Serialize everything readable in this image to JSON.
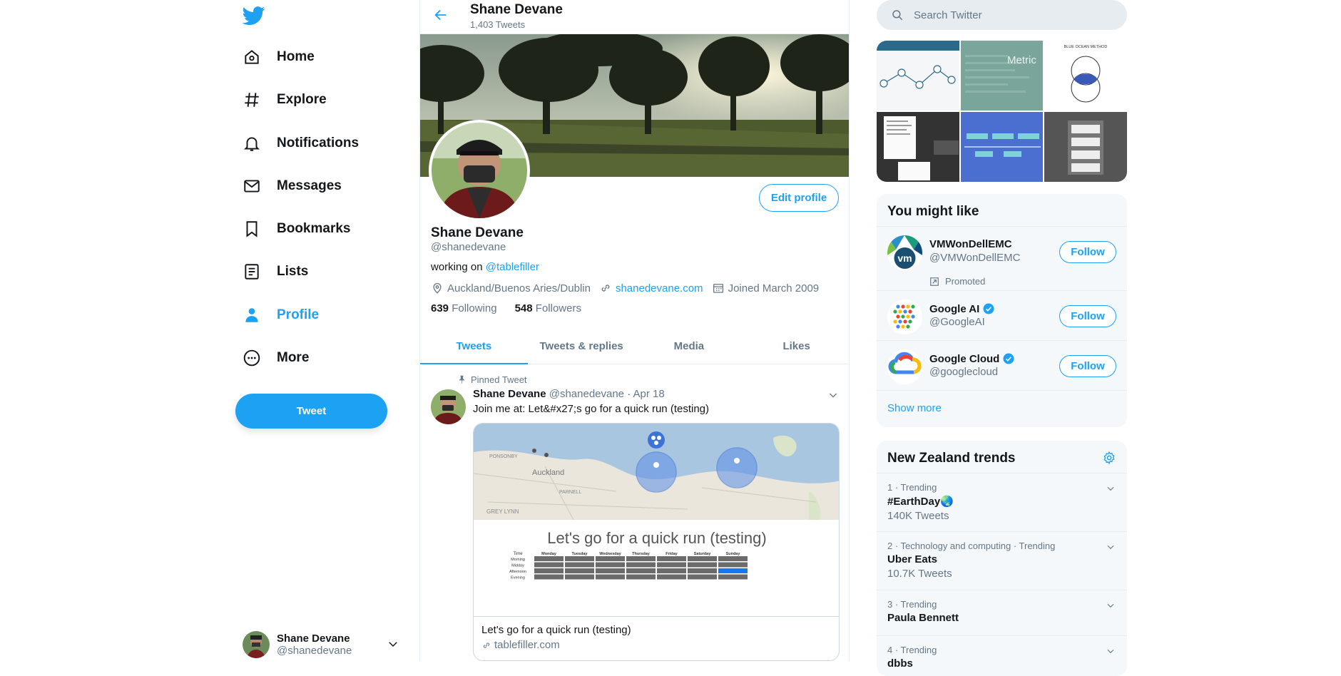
{
  "nav": {
    "items": [
      {
        "label": "Home",
        "icon": "home-icon"
      },
      {
        "label": "Explore",
        "icon": "hashtag-icon"
      },
      {
        "label": "Notifications",
        "icon": "bell-icon"
      },
      {
        "label": "Messages",
        "icon": "mail-icon"
      },
      {
        "label": "Bookmarks",
        "icon": "bookmark-icon"
      },
      {
        "label": "Lists",
        "icon": "list-icon"
      },
      {
        "label": "Profile",
        "icon": "person-icon",
        "active": true
      },
      {
        "label": "More",
        "icon": "more-circle-icon"
      }
    ],
    "tweet_button": "Tweet",
    "account": {
      "name": "Shane Devane",
      "handle": "@shanedevane"
    }
  },
  "header": {
    "title": "Shane Devane",
    "subtitle": "1,403 Tweets"
  },
  "profile": {
    "edit_button": "Edit profile",
    "name": "Shane Devane",
    "handle": "@shanedevane",
    "bio_prefix": "working on ",
    "bio_link": "@tablefiller",
    "location": "Auckland/Buenos Aries/Dublin",
    "website": "shanedevane.com",
    "joined": "Joined March 2009",
    "following_count": "639",
    "following_label": "Following",
    "followers_count": "548",
    "followers_label": "Followers"
  },
  "tabs": [
    "Tweets",
    "Tweets & replies",
    "Media",
    "Likes"
  ],
  "pinned_tweet": {
    "pinned_label": "Pinned Tweet",
    "author": "Shane Devane",
    "handle": "@shanedevane",
    "date": "· Apr 18",
    "text": "Join me at: Let&#x27;s go for a quick run (testing)",
    "card": {
      "image_title": "Let's go for a quick run (testing)",
      "table_days": [
        "Monday",
        "Tuesday",
        "Wednesday",
        "Thursday",
        "Friday",
        "Saturday",
        "Sunday"
      ],
      "table_times": [
        "Morning",
        "Midday",
        "Afternoon",
        "Evening"
      ],
      "table_header_time": "Time",
      "map_labels": [
        "Auckland",
        "PONSONBY",
        "PARNELL",
        "GREY LYNN"
      ],
      "title": "Let's go for a quick run (testing)",
      "url": "tablefiller.com"
    }
  },
  "search": {
    "placeholder": "Search Twitter"
  },
  "media_thumbs": [
    {
      "accent": "#2d6a8a"
    },
    {
      "accent": "#7aa59a",
      "text": "Metric"
    },
    {
      "accent": "#ffffff",
      "text": "BLUE OCEAN METHOD"
    },
    {
      "accent": "#333333"
    },
    {
      "accent": "#4a6fd0"
    },
    {
      "accent": "#555555"
    }
  ],
  "you_might_like": {
    "title": "You might like",
    "accounts": [
      {
        "name": "VMWonDellEMC",
        "handle": "@VMWonDellEMC",
        "promoted": "Promoted",
        "button": "Follow",
        "verified": false
      },
      {
        "name": "Google AI",
        "handle": "@GoogleAI",
        "button": "Follow",
        "verified": true
      },
      {
        "name": "Google Cloud",
        "handle": "@googlecloud",
        "button": "Follow",
        "verified": true
      }
    ],
    "show_more": "Show more"
  },
  "trends": {
    "title": "New Zealand trends",
    "items": [
      {
        "meta": "1 · Trending",
        "name": "#EarthDay🌏",
        "count": "140K Tweets"
      },
      {
        "meta": "2 · Technology and computing · Trending",
        "name": "Uber Eats",
        "count": "10.7K Tweets"
      },
      {
        "meta": "3 · Trending",
        "name": "Paula Bennett",
        "count": ""
      },
      {
        "meta": "4 · Trending",
        "name": "dbbs",
        "count": ""
      }
    ]
  },
  "colors": {
    "accent": "#1da1f2",
    "muted": "#657786",
    "border": "#e6ecf0"
  }
}
